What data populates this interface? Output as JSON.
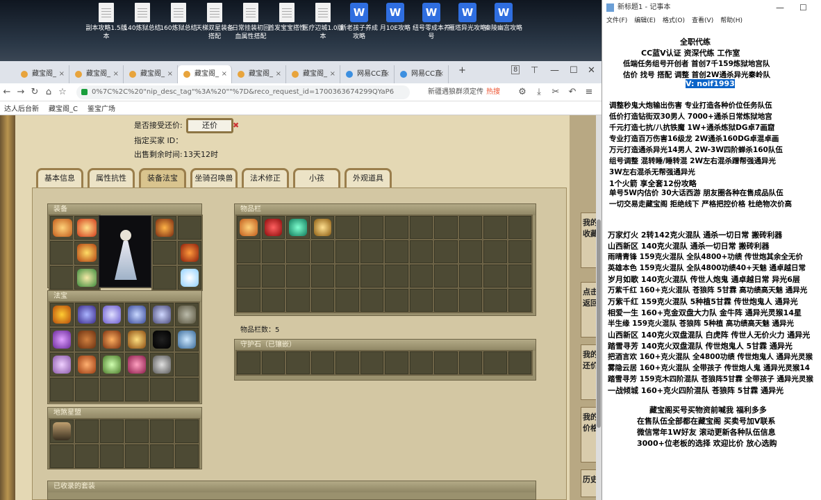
{
  "desktop": {
    "icons": [
      {
        "label": "副本攻略1.5版本",
        "type": "doc"
      },
      {
        "label": "140炼狱总结",
        "type": "doc"
      },
      {
        "label": "160炼狱总结",
        "type": "doc"
      },
      {
        "label": "天梯双星装备搭配",
        "type": "doc"
      },
      {
        "label": "日常挂装初回血属性搭配",
        "type": "doc"
      },
      {
        "label": "首发宝宝搭性",
        "type": "doc"
      },
      {
        "label": "医疗辺城1.0版本",
        "type": "doc"
      },
      {
        "label": "新老孩子养成攻略",
        "type": "wps"
      },
      {
        "label": "月10E攻略",
        "type": "wps"
      },
      {
        "label": "纽号零成本养号",
        "type": "wps"
      },
      {
        "label": "雁塔异光攻略",
        "type": "wps"
      },
      {
        "label": "秦陵幽宫攻略",
        "type": "wps"
      }
    ]
  },
  "browser": {
    "tabs": [
      "藏宝阁_",
      "藏宝阁_",
      "藏宝阁_",
      "藏宝阁_",
      "藏宝阁_",
      "藏宝阁_",
      "网易CC直",
      "网易CC直"
    ],
    "active_tab": 3,
    "tab_count_badge": "8",
    "url": "0%7C%2C%20\"nip_desc_tag\"%3A%20\"\"%7D&reco_request_id=1700363674299QYaP6",
    "search_text": "新疆遇狼群须定传",
    "search_hot": "热搜",
    "bookmarks": [
      "达人后台新",
      "藏宝阁_C",
      "鉴宝广场"
    ]
  },
  "game": {
    "accept_counter_label": "是否接受还价:",
    "counter_button": "还价",
    "counter_x": "✖",
    "designated_buyer_label": "指定买家 ID：",
    "time_left_label": "出售剩余时间:",
    "time_left_value": "13天12时",
    "tabs": [
      "基本信息",
      "属性抗性",
      "装备法宝",
      "坐骑召唤兽",
      "法术修正",
      "小孩",
      "外观道具"
    ],
    "active_tab": 2,
    "equip_title": "装备",
    "fabao_title": "法宝",
    "disha_title": "地煞星盟",
    "collected_title": "已收录的套装",
    "bag_title": "物品栏",
    "bag_count_label": "物品栏数：5",
    "guard_title": "守护石（已镶嵌）",
    "side_tabs": [
      "我的收藏",
      "点击返回",
      "我的还价",
      "我的价格",
      "历史"
    ],
    "colors": {
      "parchment": "#e4d8b4",
      "slot": "#4d4a34",
      "frame": "#9a916e"
    }
  },
  "notepad": {
    "title": "新标题1 - 记事本",
    "menu": [
      "文件(F)",
      "编辑(E)",
      "格式(O)",
      "查看(V)",
      "帮助(H)"
    ],
    "lines": [
      "全职代练",
      "CC蓝V认证  资深代练 工作室",
      "低端任务组号开创者          首创7千159炼狱地宫队",
      "估价 找号 搭配 调整          首创2W通杀异光秦岭队",
      "V:  noif1993",
      "调整秒鬼大炮输出伤害          专业打造各种价位任务队伍",
      "低价打造钻街双30男人          7000+通杀日常炼狱地宫",
      "千元打造七抗/八抗铁魔          1W+通杀炼狱DG卓7画窟",
      "专业打造百万伤害16级龙          2W通杀160DG卓混卓画",
      "万元打造通杀异光14男人          2W-3W四阶蝉杀160队伍",
      "组号调整 混转睡/睡转混          2W左右混杀蹭帮强通异光",
      "                                      3W左右混杀无帮强通异光",
      "1个火箭 享全套12份攻略",
      "单号5W内估价 30大话西游          朋友圈各种在售成品队伍",
      "一切交易走藏宝阁 拒绝线下     严格把控价格 杜绝物次价高",
      "万家灯火 2转142克火混队 通杀一切日常 搬砖利器",
      "山西新区 140克火混队 通杀一切日常 搬砖利器",
      "雨晴青锋 159克火混队 全队4800+功绩 传世炮其余全无价",
      "英雄本色 159克火混队 全队4800功绩40+天魅 通卓越日常",
      "岁月如歌 140克火混队 传世人炮鬼 通卓越日常 异光6层",
      "万紫千红 160+克火混队 苍狼阵 5甘霖 高功绩高天魅 通异光",
      "万紫千红 159克火混队 5种植5甘霖 传世炮鬼人 通异光",
      "相爱一生 160+克金双盘大力队 金牛阵 通异光灵猴14星",
      "半生缘    159克火混队 苍狼阵 5种植 高功绩高天魅 通异光",
      "山西新区 140克火双盘混队 白虎阵 传世人无价火力 通异光",
      "踏雪寻芳 140克火双盘混队 传世炮鬼人 5甘霖 通异光",
      "把酒言欢 160+克火混队 全4800功绩 传世炮鬼人 通异光灵猴",
      "雾隐云居 160+克火混队 全带孩子 传世炮人鬼 通异光灵猴14",
      "踏雪寻芳 159克木四阶混队 苍狼阵5甘霖 全带孩子 通异光灵猴",
      "一战倾城 160+克火四阶混队 苍狼阵 5甘霖 通异光",
      "藏宝阁买号买物资前喊我 福利多多",
      "在售队伍全部都在藏宝阁 买卖号加V联系",
      "微信常年1W好友 滚动更新各种队伍信息",
      "3000+位老板的选择 欢迎比价 放心选购"
    ],
    "selected_line": 4
  }
}
